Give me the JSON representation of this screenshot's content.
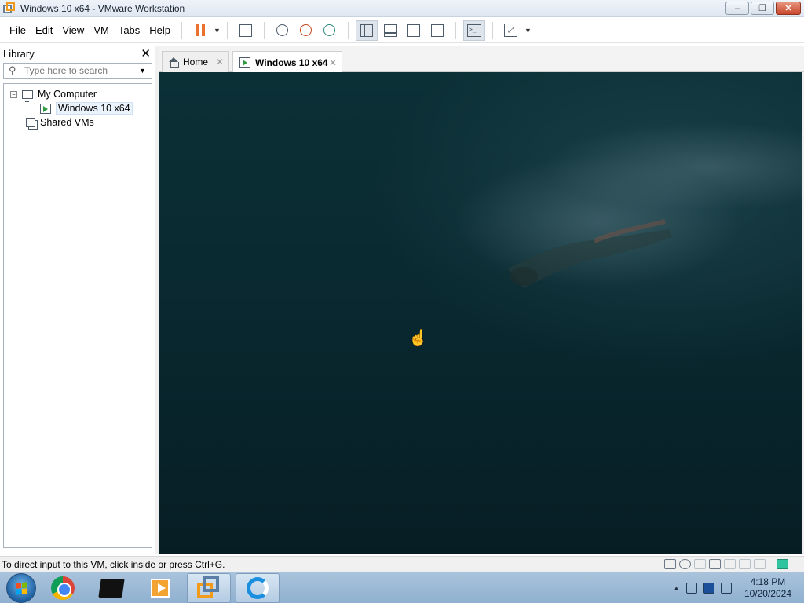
{
  "window": {
    "title": "Windows 10 x64 - VMware Workstation",
    "min_label": "‒",
    "max_label": "❐",
    "close_label": "✕"
  },
  "menu": {
    "items": [
      "File",
      "Edit",
      "View",
      "VM",
      "Tabs",
      "Help"
    ]
  },
  "library": {
    "title": "Library",
    "close_label": "✕",
    "search_placeholder": "Type here to search",
    "tree": {
      "my_computer": "My Computer",
      "vm": "Windows 10 x64",
      "shared": "Shared VMs",
      "toggle": "−"
    }
  },
  "tabs": {
    "home": "Home",
    "vm": "Windows 10 x64",
    "close": "✕"
  },
  "status": {
    "text": "To direct input to this VM, click inside or press Ctrl+G."
  },
  "taskbar": {
    "time": "4:18 PM",
    "date": "10/20/2024",
    "tray_arrow": "▲"
  },
  "icons": {
    "cursor": "☝"
  },
  "colors": {
    "pause": "#e9722e",
    "vm_bg": "#0a2a31"
  }
}
